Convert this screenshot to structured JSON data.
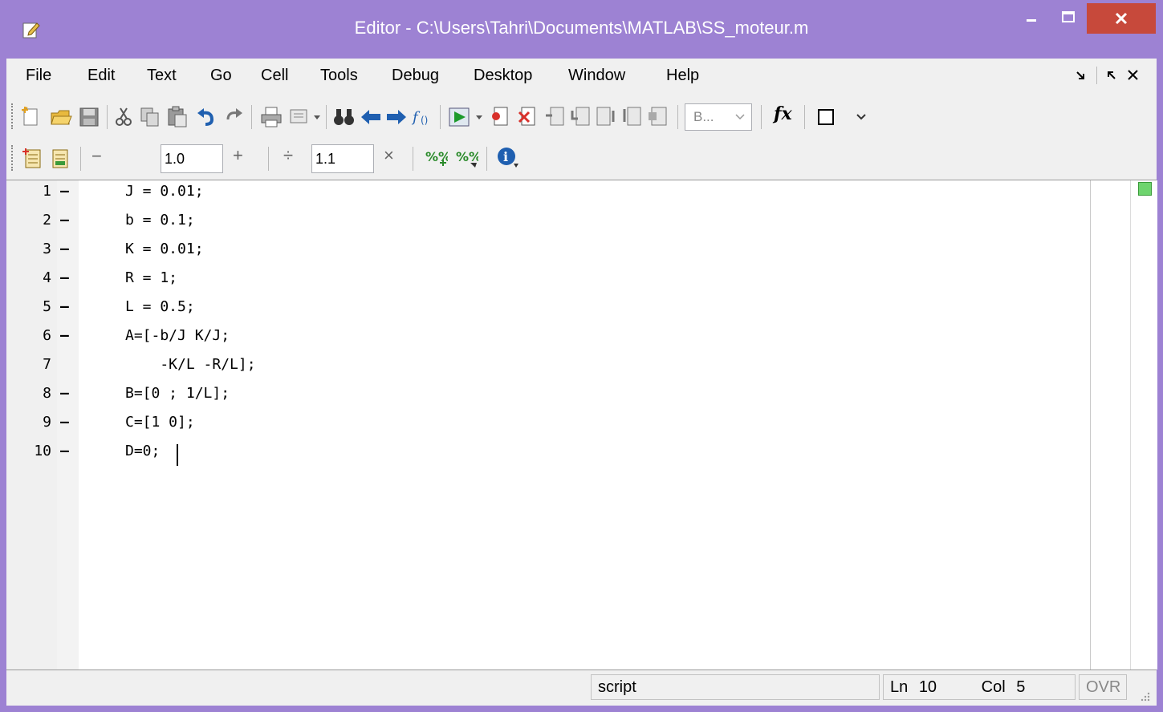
{
  "window": {
    "title": "Editor - C:\\Users\\Tahri\\Documents\\MATLAB\\SS_moteur.m",
    "accent": "#9d82d3",
    "close_color": "#c7493b"
  },
  "menu": {
    "items": [
      "File",
      "Edit",
      "Text",
      "Go",
      "Cell",
      "Tools",
      "Debug",
      "Desktop",
      "Window",
      "Help"
    ]
  },
  "toolbar": {
    "stack_dropdown": "B...",
    "fx_label": "fx"
  },
  "cell_toolbar": {
    "minus_symbol": "−",
    "decrement_value": "1.0",
    "plus_symbol": "+",
    "divide_symbol": "÷",
    "multiply_value": "1.1",
    "times_symbol": "×"
  },
  "editor": {
    "lines": [
      {
        "num": "1",
        "breakpoint": "—",
        "code": "J = 0.01;"
      },
      {
        "num": "2",
        "breakpoint": "—",
        "code": "b = 0.1;"
      },
      {
        "num": "3",
        "breakpoint": "—",
        "code": "K = 0.01;"
      },
      {
        "num": "4",
        "breakpoint": "—",
        "code": "R = 1;"
      },
      {
        "num": "5",
        "breakpoint": "—",
        "code": "L = 0.5;"
      },
      {
        "num": "6",
        "breakpoint": "—",
        "code": "A=[-b/J K/J;"
      },
      {
        "num": "7",
        "breakpoint": "",
        "code": "    -K/L -R/L];"
      },
      {
        "num": "8",
        "breakpoint": "—",
        "code": "B=[0 ; 1/L];"
      },
      {
        "num": "9",
        "breakpoint": "—",
        "code": "C=[1 0];"
      },
      {
        "num": "10",
        "breakpoint": "—",
        "code": "D=0;"
      }
    ]
  },
  "status": {
    "mode": "script",
    "ln_label": "Ln",
    "ln_value": "10",
    "col_label": "Col",
    "col_value": "5",
    "ovr": "OVR"
  }
}
